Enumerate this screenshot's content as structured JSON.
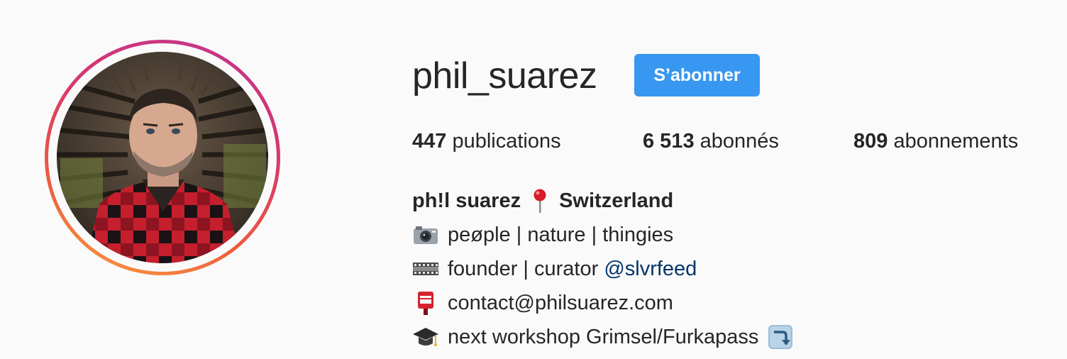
{
  "profile": {
    "username": "phil_suarez",
    "follow_label": "S’abonner",
    "avatar": "profile-photo"
  },
  "stats": {
    "posts": {
      "count": "447",
      "label": "publications"
    },
    "followers": {
      "count": "6 513",
      "label": "abonnés"
    },
    "following": {
      "count": "809",
      "label": "abonnements"
    }
  },
  "bio": {
    "name": "ph!l suarez",
    "location": "Switzerland",
    "line1": "peøple | nature | thingies",
    "line2_text": "founder | curator ",
    "line2_mention": "@slvrfeed",
    "line3": "contact@philsuarez.com",
    "line4": "next workshop Grimsel/Furkapass"
  },
  "icons": {
    "pin": "round-pushpin-icon",
    "camera": "camera-icon",
    "film": "film-strip-icon",
    "postbox": "postbox-icon",
    "grad": "graduation-cap-icon",
    "arrow": "arrow-down-right-icon"
  },
  "colors": {
    "accent": "#3897f0",
    "mention": "#003569",
    "text": "#262626"
  }
}
